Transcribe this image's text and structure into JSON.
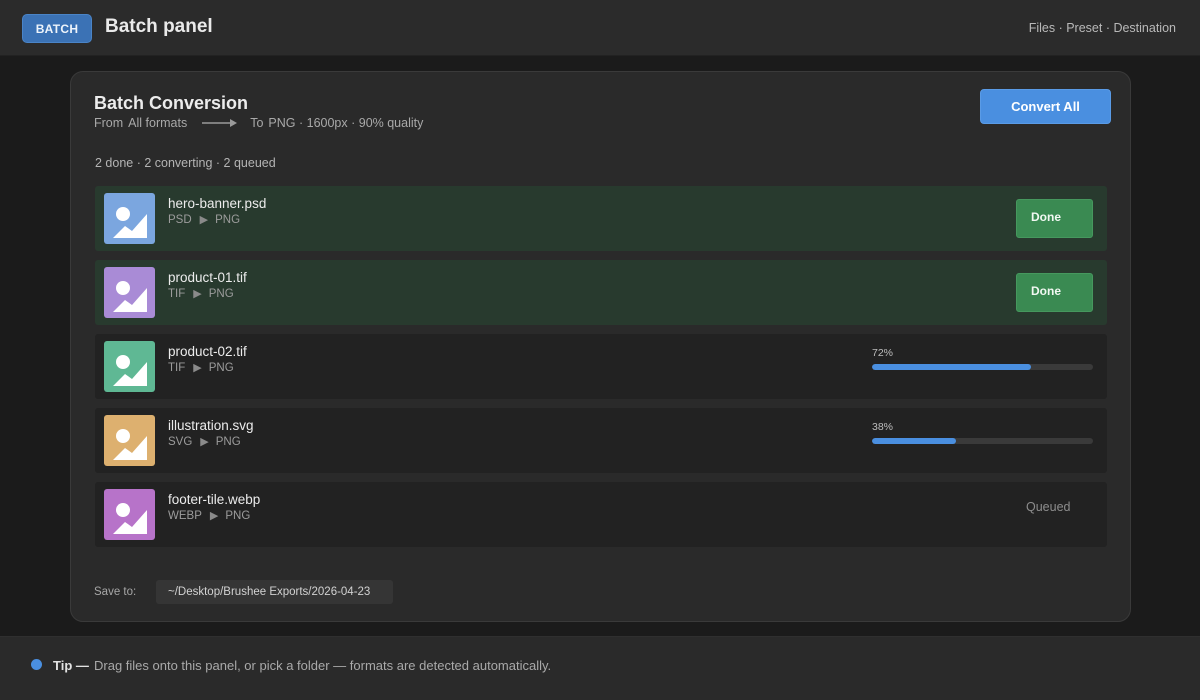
{
  "topbar": {
    "badge": "BATCH",
    "title": "Batch panel",
    "breadcrumb": "Files · Preset · Destination"
  },
  "conversion": {
    "title": "Batch Conversion",
    "from_label": "From",
    "from_value": "All formats",
    "to_label": "To",
    "to_value": "PNG · 1600px · 90% quality",
    "convert_button": "Convert All",
    "summary": "2 done · 2 converting · 2 queued"
  },
  "files": [
    {
      "name": "hero-banner.psd",
      "from": "PSD",
      "to": "PNG",
      "status": "done",
      "status_label": "Done",
      "thumb_color": "#7ba6df"
    },
    {
      "name": "product-01.tif",
      "from": "TIF",
      "to": "PNG",
      "status": "done",
      "status_label": "Done",
      "thumb_color": "#a98bd6"
    },
    {
      "name": "product-02.tif",
      "from": "TIF",
      "to": "PNG",
      "status": "converting",
      "progress_label": "72%",
      "progress": 72,
      "thumb_color": "#5fb894"
    },
    {
      "name": "illustration.svg",
      "from": "SVG",
      "to": "PNG",
      "status": "converting",
      "progress_label": "38%",
      "progress": 38,
      "thumb_color": "#ddb06f"
    },
    {
      "name": "footer-tile.webp",
      "from": "WEBP",
      "to": "PNG",
      "status": "queued",
      "status_label": "Queued",
      "thumb_color": "#b773c9"
    }
  ],
  "save": {
    "label": "Save to:",
    "path": "~/Desktop/Brushee Exports/2026-04-23"
  },
  "tip": {
    "label": "Tip —",
    "text": "Drag files onto this panel, or pick a folder — formats are detected automatically."
  },
  "colors": {
    "accent": "#4a8fe0",
    "done": "#3a8a52",
    "done_row": "#283a2e"
  },
  "icons": {
    "arrow": "right-arrow-icon",
    "format_arrow": "play-triangle-icon",
    "thumbnail": "image-icon",
    "tip": "info-dot-icon"
  }
}
